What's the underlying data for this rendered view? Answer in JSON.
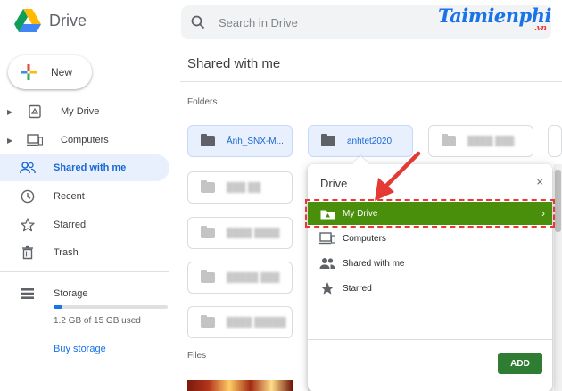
{
  "app": {
    "name": "Drive"
  },
  "search": {
    "placeholder": "Search in Drive"
  },
  "brand": {
    "name": "Taimienphi",
    "suffix": ".vn"
  },
  "sidebar": {
    "new_label": "New",
    "items": [
      {
        "label": "My Drive",
        "icon": "my-drive-icon"
      },
      {
        "label": "Computers",
        "icon": "computers-icon"
      },
      {
        "label": "Shared with me",
        "icon": "shared-icon"
      },
      {
        "label": "Recent",
        "icon": "clock-icon"
      },
      {
        "label": "Starred",
        "icon": "star-icon"
      },
      {
        "label": "Trash",
        "icon": "trash-icon"
      }
    ],
    "storage": {
      "label": "Storage",
      "used_text": "1.2 GB of 15 GB used",
      "used_fraction": 0.08,
      "buy_label": "Buy storage"
    }
  },
  "main": {
    "title": "Shared with me",
    "folders_label": "Folders",
    "files_label": "Files",
    "folders": [
      {
        "name": "Ảnh_SNX-M..."
      },
      {
        "name": "anhtet2020"
      }
    ]
  },
  "popup": {
    "title": "Drive",
    "close": "×",
    "items": [
      {
        "label": "My Drive"
      },
      {
        "label": "Computers"
      },
      {
        "label": "Shared with me"
      },
      {
        "label": "Starred"
      }
    ],
    "add_label": "ADD"
  },
  "colors": {
    "accent": "#1a73e8",
    "highlight": "#4a8f0c",
    "add_button": "#2e7d32",
    "annotation_red": "#e53935"
  }
}
